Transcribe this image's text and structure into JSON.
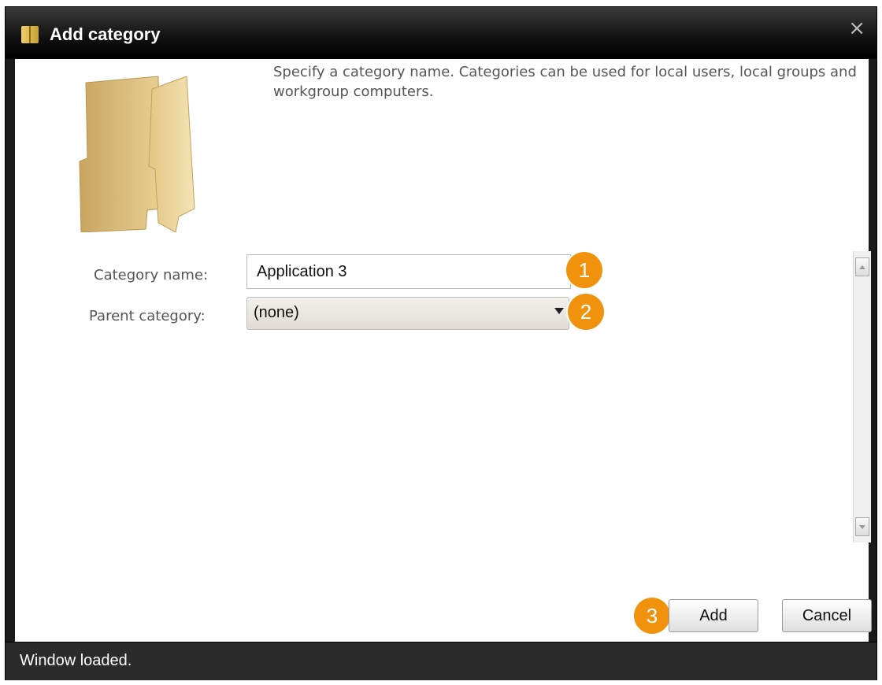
{
  "window": {
    "title": "Add category",
    "close_glyph": "×",
    "status": "Window loaded."
  },
  "description": "Specify a category name. Categories can be used for local users, local groups and workgroup computers.",
  "form": {
    "category_name_label": "Category name:",
    "category_name_value": "Application 3",
    "parent_category_label": "Parent category:",
    "parent_category_value": "(none)"
  },
  "buttons": {
    "add": "Add",
    "cancel": "Cancel"
  },
  "badges": {
    "one": "1",
    "two": "2",
    "three": "3"
  },
  "icons": {
    "title": "folder-icon",
    "hero": "folder-icon",
    "close": "close-icon"
  },
  "colors": {
    "badge": "#f0920c",
    "titlebar": "#000000",
    "statusbar": "#2b2b2b"
  }
}
